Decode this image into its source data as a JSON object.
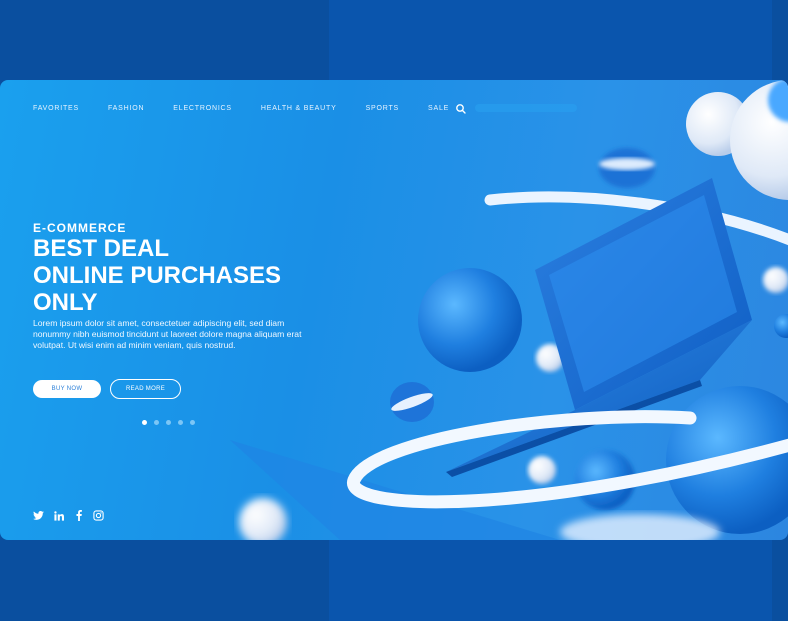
{
  "nav": {
    "items": [
      {
        "label": "FAVORITES"
      },
      {
        "label": "FASHION"
      },
      {
        "label": "ELECTRONICS"
      },
      {
        "label": "HEALTH & BEAUTY"
      },
      {
        "label": "SPORTS"
      },
      {
        "label": "SALE"
      }
    ]
  },
  "search": {
    "placeholder": "",
    "icon": "search-icon"
  },
  "hero": {
    "kicker": "E-COMMERCE",
    "title_lines": [
      "BEST DEAL",
      "ONLINE PURCHASES",
      "ONLY"
    ],
    "description": "Lorem ipsum dolor sit amet, consectetuer adipiscing elit, sed diam nonummy nibh euismod tincidunt ut laoreet dolore magna aliquam erat volutpat. Ut wisi enim ad minim veniam, quis nostrud.",
    "buy_label": "BUY NOW",
    "read_label": "READ MORE"
  },
  "slider": {
    "count": 5,
    "active_index": 0
  },
  "social": {
    "icons": [
      "twitter-icon",
      "linkedin-icon",
      "facebook-icon",
      "instagram-icon"
    ]
  },
  "colors": {
    "background": "#0a55ad",
    "card_start": "#1aa0ee",
    "card_end": "#2c86e0",
    "accent_white": "#ffffff",
    "button_text": "#2a7fd8"
  }
}
